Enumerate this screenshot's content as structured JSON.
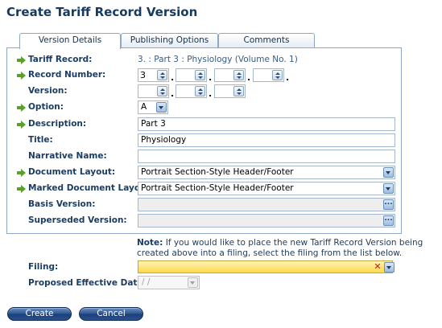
{
  "page_title": "Create Tariff Record Version",
  "tabs": [
    {
      "label": "Version Details",
      "active": true
    },
    {
      "label": "Publishing Options",
      "active": false
    },
    {
      "label": "Comments",
      "active": false
    }
  ],
  "fields": {
    "tariff_record": {
      "label": "Tariff Record:",
      "value": "3. : Part 3 : Physiology (Volume No. 1)"
    },
    "record_number": {
      "label": "Record Number:",
      "parts": [
        "3",
        "",
        "",
        ""
      ]
    },
    "version": {
      "label": "Version:",
      "parts": [
        "",
        "",
        ""
      ]
    },
    "option": {
      "label": "Option:",
      "value": "A"
    },
    "description": {
      "label": "Description:",
      "value": "Part 3"
    },
    "title": {
      "label": "Title:",
      "value": "Physiology"
    },
    "narrative_name": {
      "label": "Narrative Name:",
      "value": ""
    },
    "document_layout": {
      "label": "Document Layout:",
      "value": "Portrait Section-Style Header/Footer"
    },
    "marked_document_layout": {
      "label": "Marked Document Layout:",
      "value": "Portrait Section-Style Header/Footer"
    },
    "basis_version": {
      "label": "Basis Version:",
      "value": ""
    },
    "superseded_version": {
      "label": "Superseded Version:",
      "value": ""
    }
  },
  "separator": ".",
  "ellipsis": "...",
  "note": {
    "heading": "Note:",
    "text": "If you would like to place the new Tariff Record Version being created above into a filing, select the filing from the list below."
  },
  "filing": {
    "label": "Filing:",
    "value": "",
    "clear_glyph": "✕"
  },
  "proposed_effective_date": {
    "label": "Proposed Effective Date:",
    "value": " /  / "
  },
  "buttons": {
    "create": "Create",
    "cancel": "Cancel"
  },
  "colors": {
    "required_arrow": "#5aa12a",
    "label": "#1b3d63",
    "filing_highlight": "#ffd84a",
    "button": "#2e5690"
  }
}
